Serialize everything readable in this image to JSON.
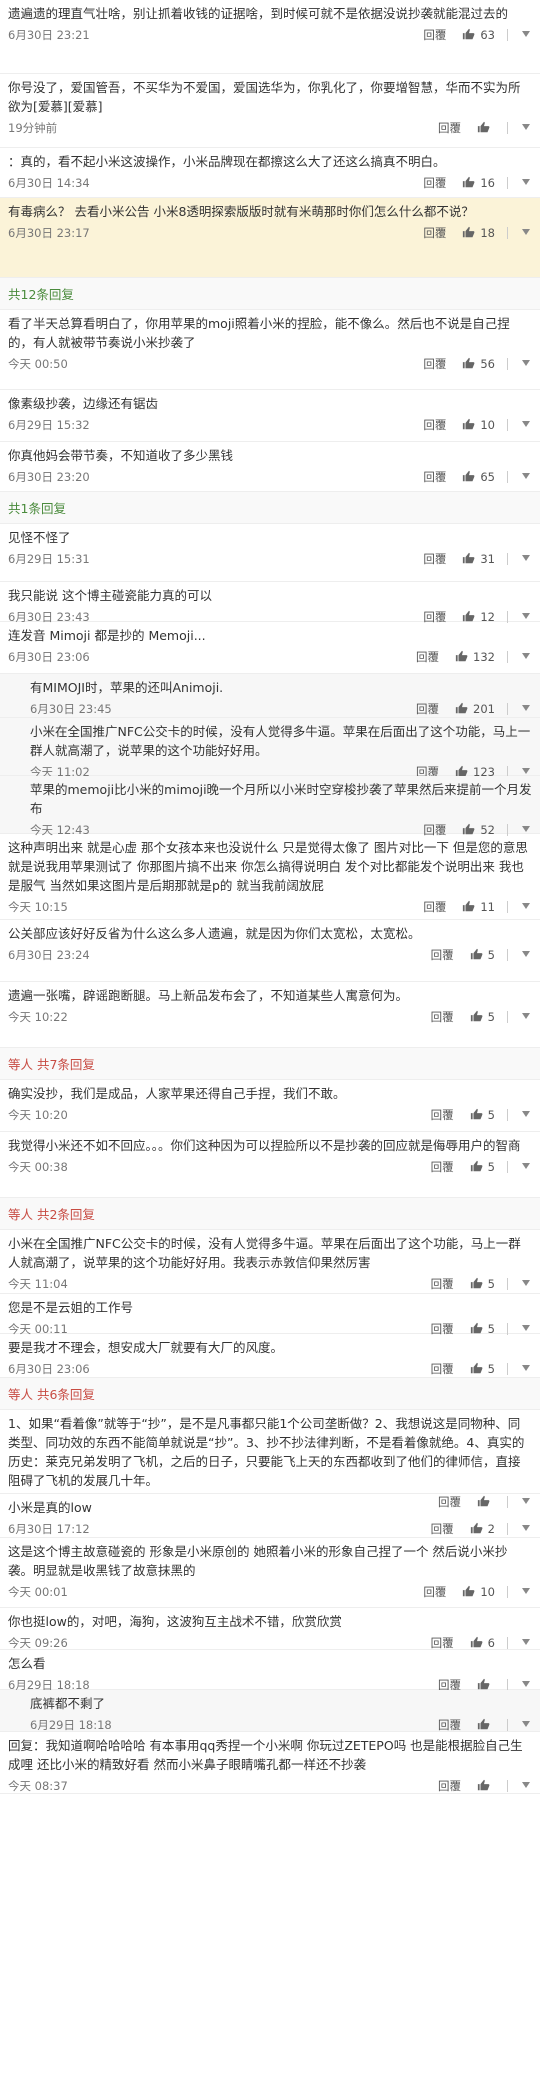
{
  "labels": {
    "reply": "回覆"
  },
  "comments": [
    {
      "name": "",
      "text": "遗遍遗的理直气壮啥，别让抓着收钱的证据啥，到时候可就不是依据没说抄袭就能混过去的",
      "time": "6月30日 23:21",
      "likes": "63"
    },
    {
      "name": "",
      "text": "你号没了，爱国管吾，不买华为不爱国，爱国选华为，你乳化了，你要增智慧，华而不实为所欲为[爱慕][爱慕]",
      "time": "19分钟前",
      "likes": ""
    },
    {
      "name": "",
      "text": "：真的，看不起小米这波操作，小米品牌现在都擦这么大了还这么搞真不明白。",
      "time": "6月30日 14:34",
      "likes": "16"
    },
    {
      "name": "",
      "text": "有毒病么？ 去看小米公告 小米8透明探索版版时就有米萌那时你们怎么什么都不说？",
      "time": "6月30日 23:17",
      "likes": "18"
    },
    {
      "name": "",
      "text": "看了半天总算看明白了，你用苹果的moji照着小米的捏脸，能不像么。然后也不说是自己捏的，有人就被带节奏说小米抄袭了",
      "time": "今天 00:50",
      "likes": "56"
    },
    {
      "name": "",
      "text": "像素级抄袭，边缘还有锯齿",
      "time": "6月29日 15:32",
      "likes": "10"
    },
    {
      "name": "",
      "text": "你真他妈会带节奏，不知道收了多少黑钱",
      "time": "6月30日 23:20",
      "likes": "65"
    },
    {
      "name": "",
      "text": "见怪不怪了",
      "time": "6月29日 15:31",
      "likes": "31"
    },
    {
      "name": "",
      "text": "我只能说 这个博主碰瓷能力真的可以",
      "time": "6月30日 23:43",
      "likes": "12"
    },
    {
      "name": "",
      "text": "连发音 Mimoji 都是抄的 Memoji...",
      "time": "6月30日 23:06",
      "likes": "132"
    },
    {
      "name": "",
      "text": "有MIMOJI时，苹果的还叫Animoji.",
      "time": "6月30日 23:45",
      "likes": "201"
    },
    {
      "name": "",
      "text": "小米在全国推广NFC公交卡的时候，没有人觉得多牛逼。苹果在后面出了这个功能，马上一群人就高潮了，说苹果的这个功能好好用。",
      "time": "今天 11:02",
      "likes": "123"
    },
    {
      "name": "",
      "text": "苹果的memoji比小米的mimoji晚一个月所以小米时空穿梭抄袭了苹果然后来提前一个月发布",
      "time": "今天 12:43",
      "likes": "52"
    },
    {
      "name": "",
      "text": "这种声明出来 就是心虚 那个女孩本来也没说什么 只是觉得太像了 图片对比一下 但是您的意思就是说我用苹果测试了 你那图片搞不出来 你怎么搞得说明白 发个对比都能发个说明出来 我也是服气 当然如果这图片是后期那就是p的 就当我前阔放屁",
      "time": "今天 10:15",
      "likes": "11"
    },
    {
      "name": "",
      "text": "公关部应该好好反省为什么这么多人遗遍，就是因为你们太宽松，太宽松。",
      "time": "6月30日 23:24",
      "likes": "5"
    },
    {
      "name": "",
      "text": "遗遍一张嘴，辟谣跑断腿。马上新品发布会了，不知道某些人寓意何为。",
      "time": "今天 10:22",
      "likes": "5"
    },
    {
      "name": "",
      "text": "确实没抄，我们是成品，人家苹果还得自己手捏，我们不敢。",
      "time": "今天 10:20",
      "likes": "5"
    },
    {
      "name": "",
      "text": "我觉得小米还不如不回应。。。你们这种因为可以捏脸所以不是抄袭的回应就是侮辱用户的智商",
      "time": "今天 00:38",
      "likes": "5"
    },
    {
      "name": "",
      "text": "小米在全国推广NFC公交卡的时候，没有人觉得多牛逼。苹果在后面出了这个功能，马上一群人就高潮了，说苹果的这个功能好好用。我表示赤敦信仰果然厉害",
      "time": "今天 11:04",
      "likes": "5"
    },
    {
      "name": "",
      "text": "您是不是云姐的工作号",
      "time": "今天 00:11",
      "likes": "5"
    },
    {
      "name": "",
      "text": "要是我才不理会，想安成大厂就要有大厂的风度。",
      "time": "6月30日 23:06",
      "likes": "5"
    },
    {
      "name": "",
      "text": "1、如果“看着像”就等于“抄”，是不是凡事都只能1个公司垄断做？2、我想说这是同物种、同类型、同功效的东西不能简单就说是“抄”。3、抄不抄法律判断，不是看着像就绝。4、真实的历史：莱克兄弟发明了飞机，之后的日子，只要能飞上天的东西都收到了他们的律师信，直接阻碍了飞机的发展几十年。",
      "time": "",
      "likes": ""
    },
    {
      "name": "",
      "text": "小米是真的low",
      "time": "6月30日 17:12",
      "likes": "2"
    },
    {
      "name": "",
      "text": "这是这个博主故意碰瓷的 形象是小米原创的 她照着小米的形象自己捏了一个 然后说小米抄袭。明显就是收黑钱了故意抹黑的",
      "time": "今天 00:01",
      "likes": "10"
    },
    {
      "name": "",
      "text": "你也挺low的，对吧，海狗，这波狗互主战术不错，欣赏欣赏",
      "time": "今天 09:26",
      "likes": "6"
    },
    {
      "name": "",
      "text": "怎么看",
      "time": "6月29日 18:18",
      "likes": ""
    },
    {
      "name": "",
      "text": "底裤都不剩了",
      "time": "6月29日 18:18",
      "likes": ""
    },
    {
      "name": "",
      "text": "回复：我知道啊哈哈哈哈 有本事用qq秀捏一个小米啊 你玩过ZETEPO吗 也是能根据脸自己生成哩 还比小米的精致好看 然而小米鼻子眼睛嘴孔都一样还不抄袭",
      "time": "今天 08:37",
      "likes": ""
    }
  ],
  "more_links": [
    {
      "text": "共12条回复"
    },
    {
      "text": "共1条回复"
    },
    {
      "text": "共1条回复"
    },
    {
      "text": "等人 共7条回复"
    },
    {
      "text": "等人 共2条回复"
    },
    {
      "text": "等人 共6条回复"
    }
  ],
  "colors": {
    "accent": "#eb7350",
    "link": "#4a8b3c"
  }
}
